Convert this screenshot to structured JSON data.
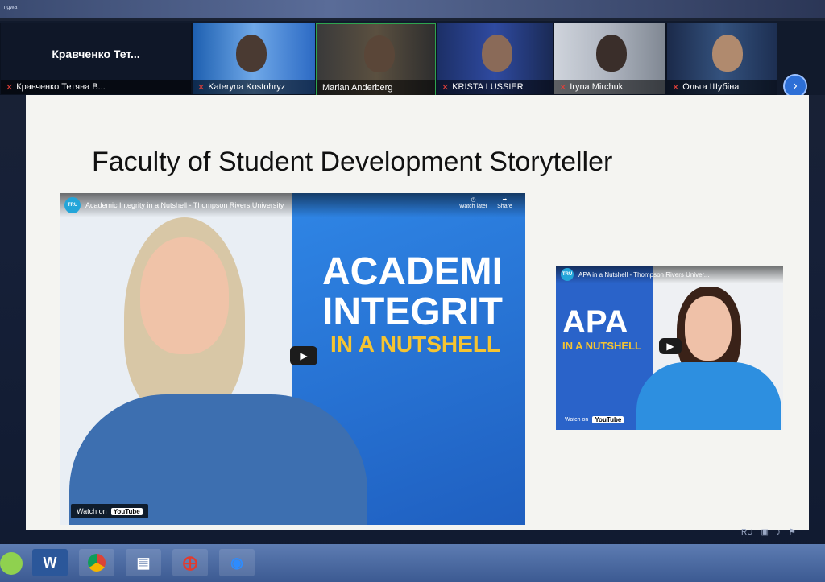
{
  "window": {
    "tiny_label": "т.gwa"
  },
  "participants": [
    {
      "name": "Кравченко Тетяна В...",
      "display": "Кравченко  Тет...",
      "muted": true
    },
    {
      "name": "Kateryna Kostohryz",
      "muted": true
    },
    {
      "name": "Marian Anderberg",
      "muted": false,
      "active": true
    },
    {
      "name": "KRISTA LUSSIER",
      "muted": true
    },
    {
      "name": "Iryna Mirchuk",
      "muted": true
    },
    {
      "name": "Ольга Шубіна",
      "muted": true
    }
  ],
  "slide": {
    "title": "Faculty of Student Development Storyteller",
    "video1": {
      "title": "Academic Integrity in a Nutshell - Thompson Rivers University",
      "line1": "ACADEMI",
      "line2": "INTEGRIT",
      "line3": "IN A NUTSHELL",
      "watch_later": "Watch later",
      "share": "Share",
      "watch_on": "Watch on",
      "youtube": "YouTube",
      "logo": "TRU"
    },
    "video2": {
      "title": "APA in a Nutshell - Thompson Rivers Univer...",
      "line1": "APA",
      "line3": "IN A NUTSHELL",
      "watch_on": "Watch on",
      "youtube": "YouTube",
      "logo": "TRU"
    }
  },
  "tray": {
    "lang": "RU"
  },
  "taskbar": {
    "items": [
      "start-orb",
      "word",
      "chrome",
      "save",
      "acrobat",
      "zoom"
    ],
    "word_label": "W"
  },
  "colors": {
    "accent_yellow": "#f5c431",
    "slide_bg": "#f4f4f1",
    "youtube_blue": "#2b7ad8"
  }
}
